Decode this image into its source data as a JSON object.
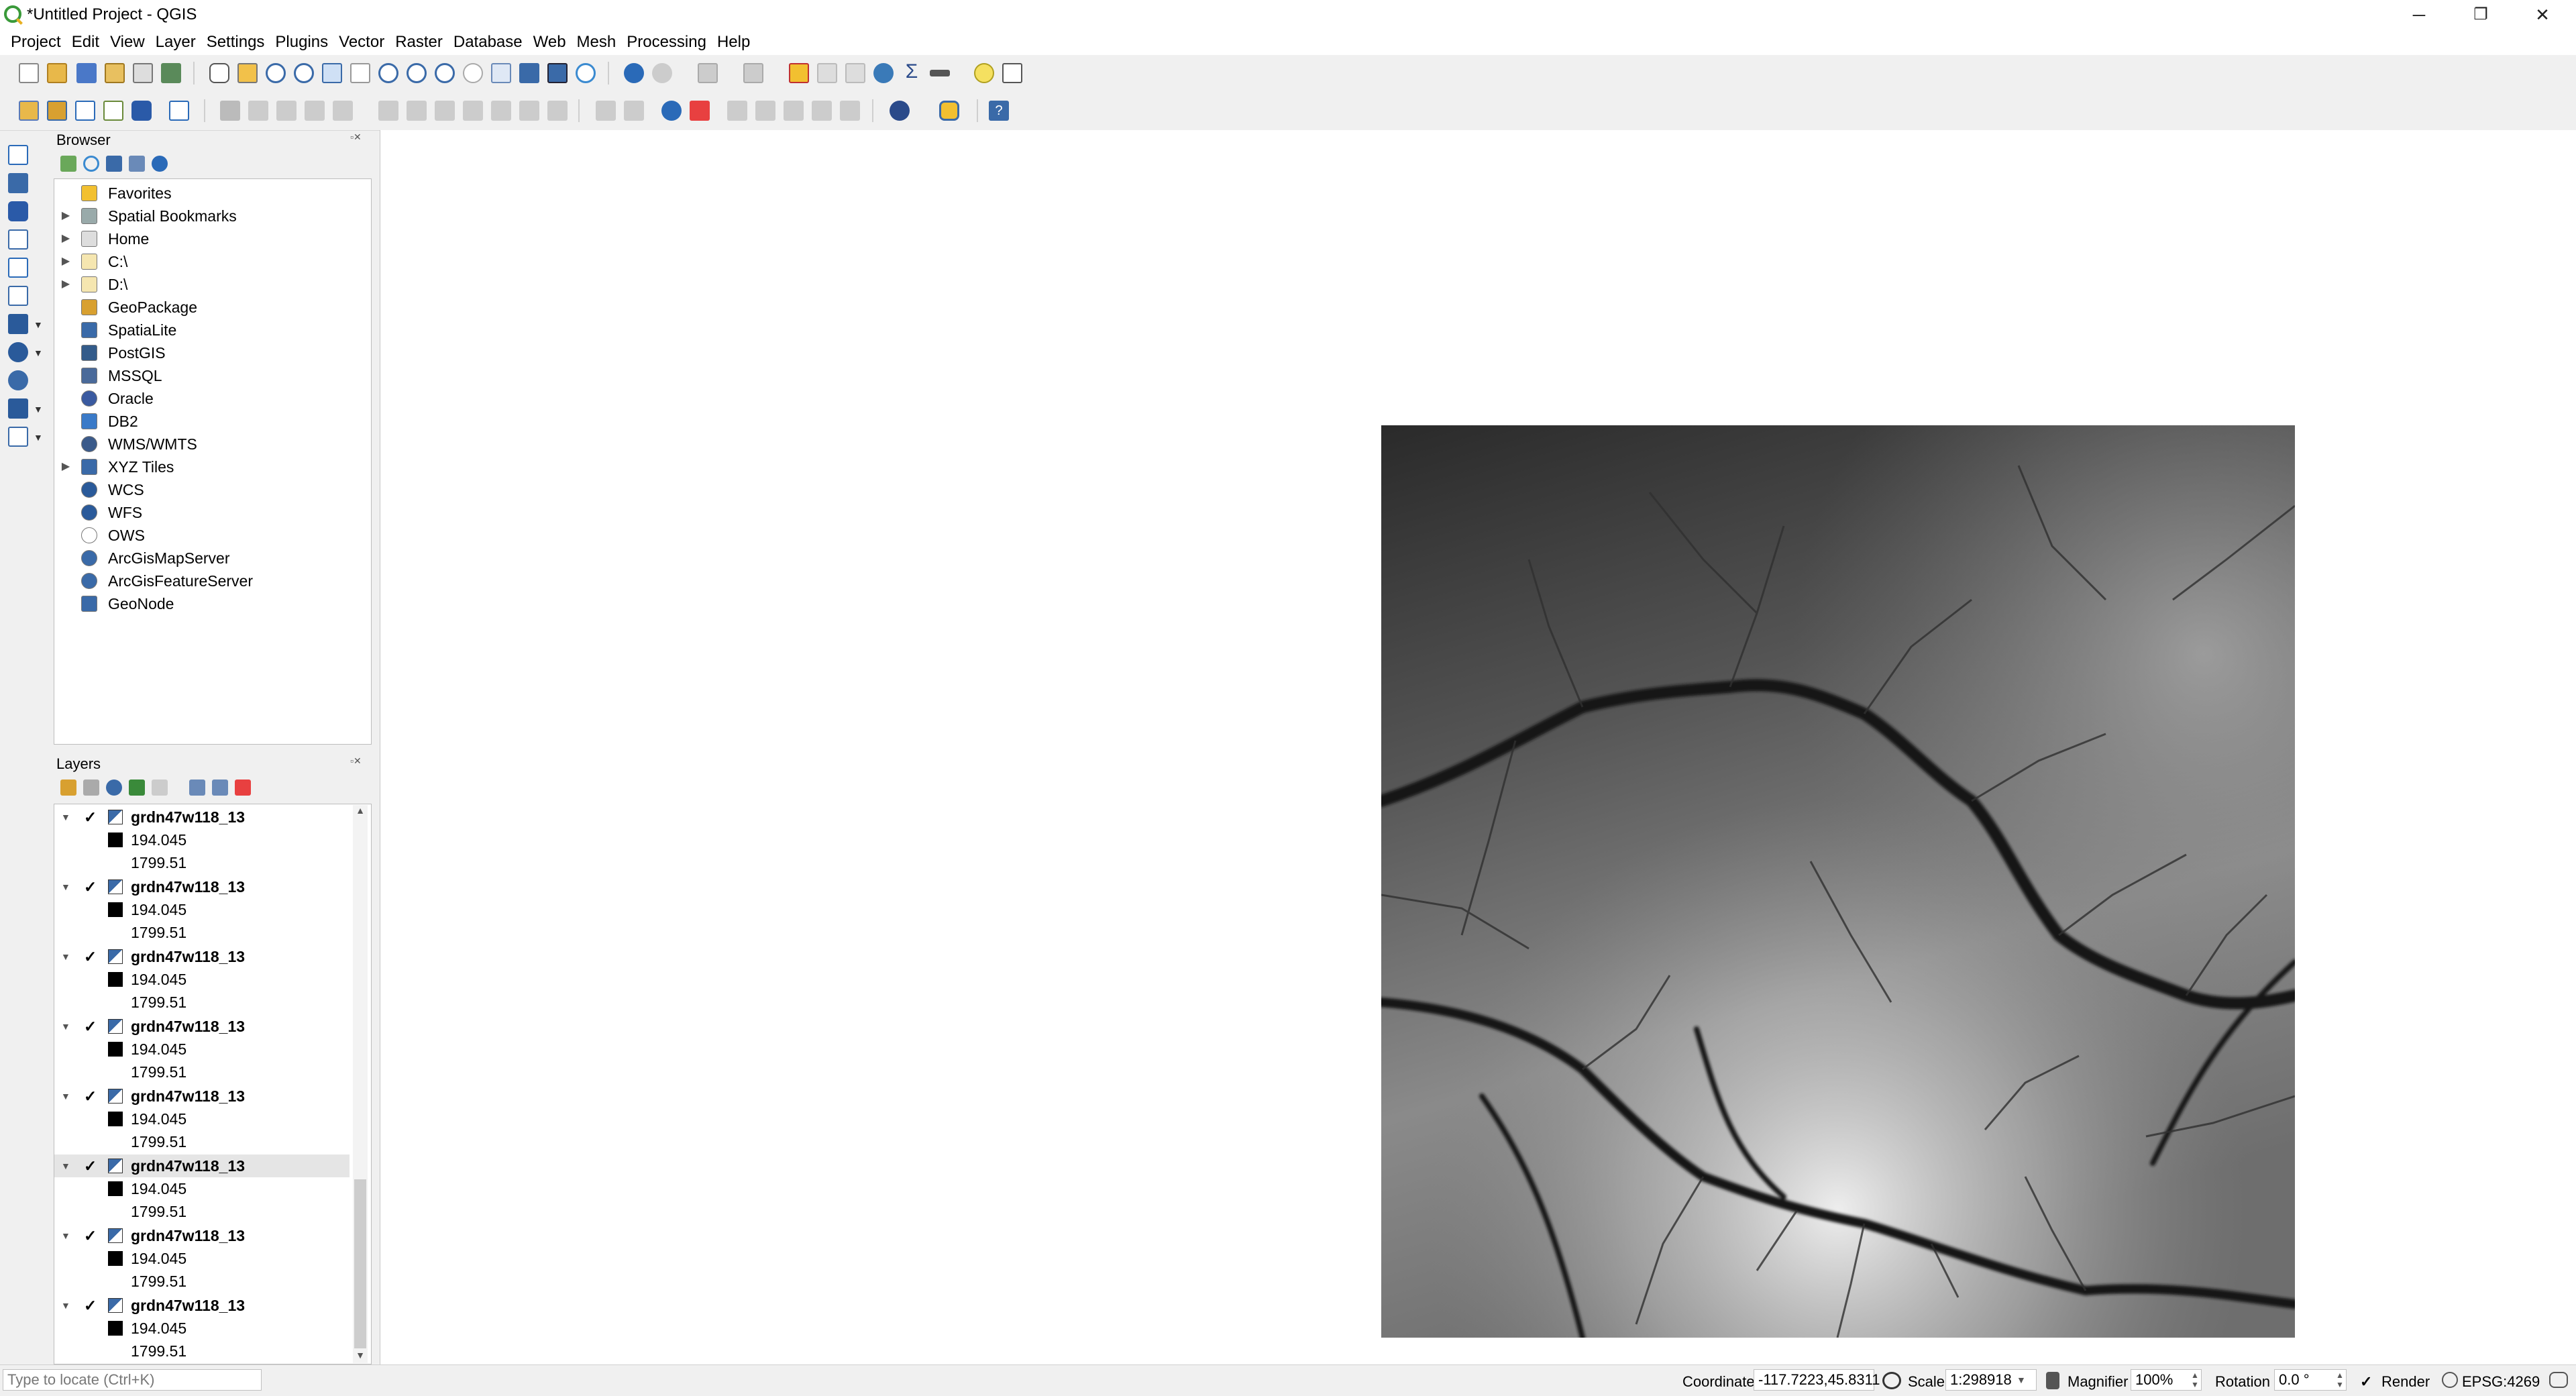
{
  "window": {
    "title": "*Untitled Project - QGIS",
    "minimize": "─",
    "restore": "❐",
    "close": "✕"
  },
  "menu": [
    "Project",
    "Edit",
    "View",
    "Layer",
    "Settings",
    "Plugins",
    "Vector",
    "Raster",
    "Database",
    "Web",
    "Mesh",
    "Processing",
    "Help"
  ],
  "browser": {
    "title": "Browser",
    "items": [
      {
        "label": "Favorites",
        "icon": "star-icon",
        "expandable": false
      },
      {
        "label": "Spatial Bookmarks",
        "icon": "bookmark-icon",
        "expandable": true
      },
      {
        "label": "Home",
        "icon": "home-folder-icon",
        "expandable": true
      },
      {
        "label": "C:\\",
        "icon": "folder-icon",
        "expandable": true
      },
      {
        "label": "D:\\",
        "icon": "folder-icon",
        "expandable": true
      },
      {
        "label": "GeoPackage",
        "icon": "geopackage-icon",
        "expandable": false
      },
      {
        "label": "SpatiaLite",
        "icon": "spatialite-icon",
        "expandable": false
      },
      {
        "label": "PostGIS",
        "icon": "postgis-icon",
        "expandable": false
      },
      {
        "label": "MSSQL",
        "icon": "mssql-icon",
        "expandable": false
      },
      {
        "label": "Oracle",
        "icon": "oracle-icon",
        "expandable": false
      },
      {
        "label": "DB2",
        "icon": "db2-icon",
        "expandable": false
      },
      {
        "label": "WMS/WMTS",
        "icon": "wms-icon",
        "expandable": false
      },
      {
        "label": "XYZ Tiles",
        "icon": "xyz-icon",
        "expandable": true
      },
      {
        "label": "WCS",
        "icon": "wcs-icon",
        "expandable": false
      },
      {
        "label": "WFS",
        "icon": "wfs-icon",
        "expandable": false
      },
      {
        "label": "OWS",
        "icon": "ows-icon",
        "expandable": false
      },
      {
        "label": "ArcGisMapServer",
        "icon": "arcgis-map-icon",
        "expandable": false
      },
      {
        "label": "ArcGisFeatureServer",
        "icon": "arcgis-feature-icon",
        "expandable": false
      },
      {
        "label": "GeoNode",
        "icon": "geonode-icon",
        "expandable": false
      }
    ]
  },
  "layers": {
    "title": "Layers",
    "items": [
      {
        "name": "grdn47w118_13",
        "checked": "✓",
        "min": "194.045",
        "max": "1799.51",
        "selected": false
      },
      {
        "name": "grdn47w118_13",
        "checked": "✓",
        "min": "194.045",
        "max": "1799.51",
        "selected": false
      },
      {
        "name": "grdn47w118_13",
        "checked": "✓",
        "min": "194.045",
        "max": "1799.51",
        "selected": false
      },
      {
        "name": "grdn47w118_13",
        "checked": "✓",
        "min": "194.045",
        "max": "1799.51",
        "selected": false
      },
      {
        "name": "grdn47w118_13",
        "checked": "✓",
        "min": "194.045",
        "max": "1799.51",
        "selected": false
      },
      {
        "name": "grdn47w118_13",
        "checked": "✓",
        "min": "194.045",
        "max": "1799.51",
        "selected": true
      },
      {
        "name": "grdn47w118_13",
        "checked": "✓",
        "min": "194.045",
        "max": "1799.51",
        "selected": false
      },
      {
        "name": "grdn47w118_13",
        "checked": "✓",
        "min": "194.045",
        "max": "1799.51",
        "selected": false
      }
    ]
  },
  "status": {
    "locate_placeholder": "Type to locate (Ctrl+K)",
    "coordinate_label": "Coordinate",
    "coordinate_value": "-117.7223,45.8311",
    "scale_label": "Scale",
    "scale_value": "1:298918",
    "magnifier_label": "Magnifier",
    "magnifier_value": "100%",
    "rotation_label": "Rotation",
    "rotation_value": "0.0 °",
    "render_label": "Render",
    "render_checked": "✓",
    "crs": "EPSG:4269"
  }
}
